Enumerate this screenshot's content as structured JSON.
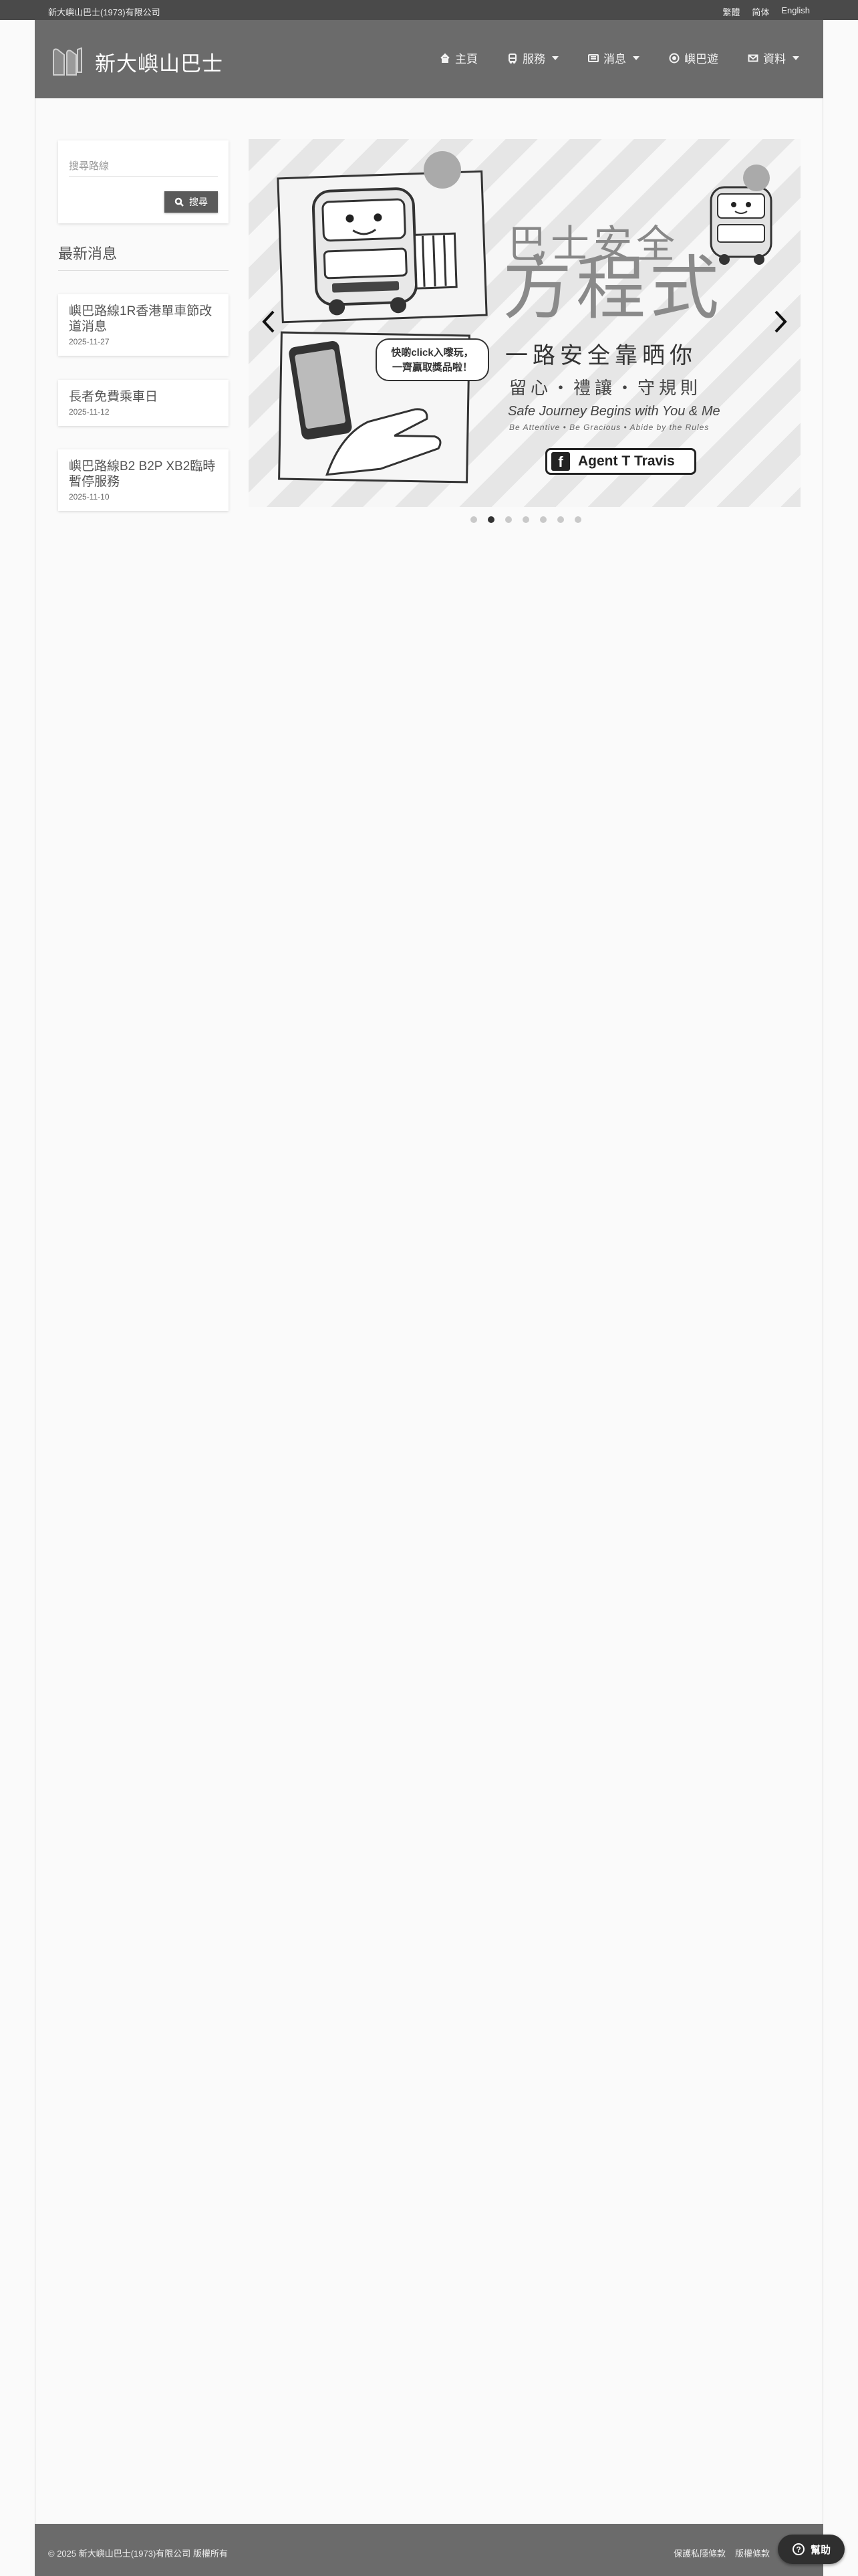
{
  "topbar": {
    "company": "新大嶼山巴士(1973)有限公司",
    "languages": [
      "繁體",
      "简体",
      "English"
    ]
  },
  "brand": {
    "name": "新大嶼山巴士"
  },
  "nav": {
    "items": [
      {
        "label": "主頁",
        "icon": "home-icon",
        "dropdown": false
      },
      {
        "label": "服務",
        "icon": "bus-icon",
        "dropdown": true
      },
      {
        "label": "消息",
        "icon": "newspaper-icon",
        "dropdown": true
      },
      {
        "label": "嶼巴遊",
        "icon": "compass-icon",
        "dropdown": false
      },
      {
        "label": "資料",
        "icon": "envelope-icon",
        "dropdown": true
      }
    ]
  },
  "search": {
    "placeholder": "搜尋路線",
    "button_label": "搜尋"
  },
  "news": {
    "heading": "最新消息",
    "items": [
      {
        "title": "嶼巴路線1R香港單車節改道消息",
        "date": "2025-11-27"
      },
      {
        "title": "長者免費乘車日",
        "date": "2025-11-12"
      },
      {
        "title": "嶼巴路線B2 B2P XB2臨時暫停服務",
        "date": "2025-11-10"
      }
    ]
  },
  "carousel": {
    "slide": {
      "title_small": "巴士安全",
      "title_big": "方程式",
      "line1": "一路安全靠晒你",
      "line2": "留心・禮讓・守規則",
      "english": "Safe Journey Begins with You & Me",
      "english_sub": "Be Attentive • Be Gracious • Abide by the Rules",
      "speech": [
        "快啲click入嚟玩，",
        "一齊贏取獎品啦！"
      ],
      "fb_label": "Agent T Travis"
    },
    "dot_count": 7,
    "active_index": 1
  },
  "footer": {
    "copyright": "© 2025 新大嶼山巴士(1973)有限公司 版權所有",
    "links": [
      "保護私隱條款",
      "版權條款"
    ]
  },
  "help": {
    "label": "幫助"
  },
  "colors": {
    "topbar": "#4a4a4a",
    "navbar": "#6b6b6b",
    "footer": "#6b6b6b",
    "accent": "#5a5a5a"
  }
}
